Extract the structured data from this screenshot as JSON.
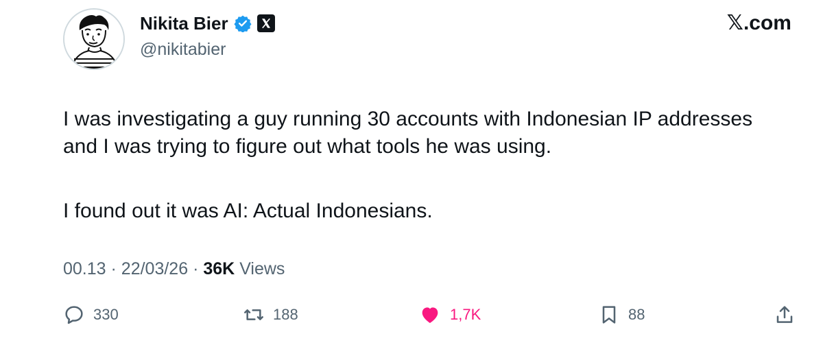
{
  "author": {
    "name": "Nikita Bier",
    "handle": "@nikitabier",
    "verified_color": "#1d9bf0"
  },
  "site": "𝕏.com",
  "post": {
    "paragraph_1": "I was investigating a guy running 30 accounts with Indonesian IP addresses and I was trying to figure out what tools he was using.",
    "paragraph_2": "I found out it was AI: Actual Indonesians."
  },
  "meta": {
    "time": "00.13",
    "separator": "·",
    "date": "22/03/26",
    "views_count": "36K",
    "views_label": "Views"
  },
  "actions": {
    "replies": "330",
    "reposts": "188",
    "likes": "1,7K",
    "bookmarks": "88",
    "like_color": "#f91880",
    "icons": [
      "reply-icon",
      "repost-icon",
      "heart-icon",
      "bookmark-icon",
      "share-icon"
    ]
  }
}
